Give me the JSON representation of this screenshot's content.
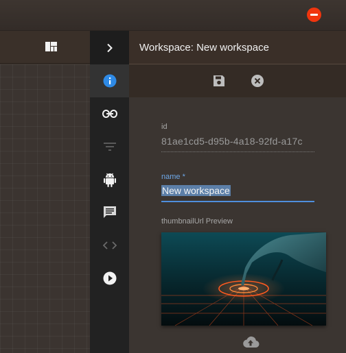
{
  "window": {
    "close_icon": "remove-circle-icon",
    "close_color": "#f0350e"
  },
  "header": {
    "layout_icon": "dashboard-icon",
    "expand_icon": "chevron-right-icon",
    "title": "Workspace: New workspace"
  },
  "toolbar": {
    "save_icon": "save-icon",
    "cancel_icon": "cancel-icon"
  },
  "rail": {
    "items": [
      {
        "icon": "info-icon",
        "active": true,
        "color": "#2e8ae6"
      },
      {
        "icon": "link-icon",
        "active": false
      },
      {
        "icon": "filter-icon",
        "active": false
      },
      {
        "icon": "android-icon",
        "active": false
      },
      {
        "icon": "comment-icon",
        "active": false
      },
      {
        "icon": "code-icon",
        "active": false
      },
      {
        "icon": "play-icon",
        "active": false
      }
    ]
  },
  "form": {
    "id": {
      "label": "id",
      "value": "81ae1cd5-d95b-4a18-92fd-a17c"
    },
    "name": {
      "label": "name *",
      "value": "New workspace",
      "accent": "#4f8fdd"
    },
    "thumbnail": {
      "label": "thumbnailUrl Preview",
      "upload_icon": "cloud-upload-icon"
    }
  }
}
